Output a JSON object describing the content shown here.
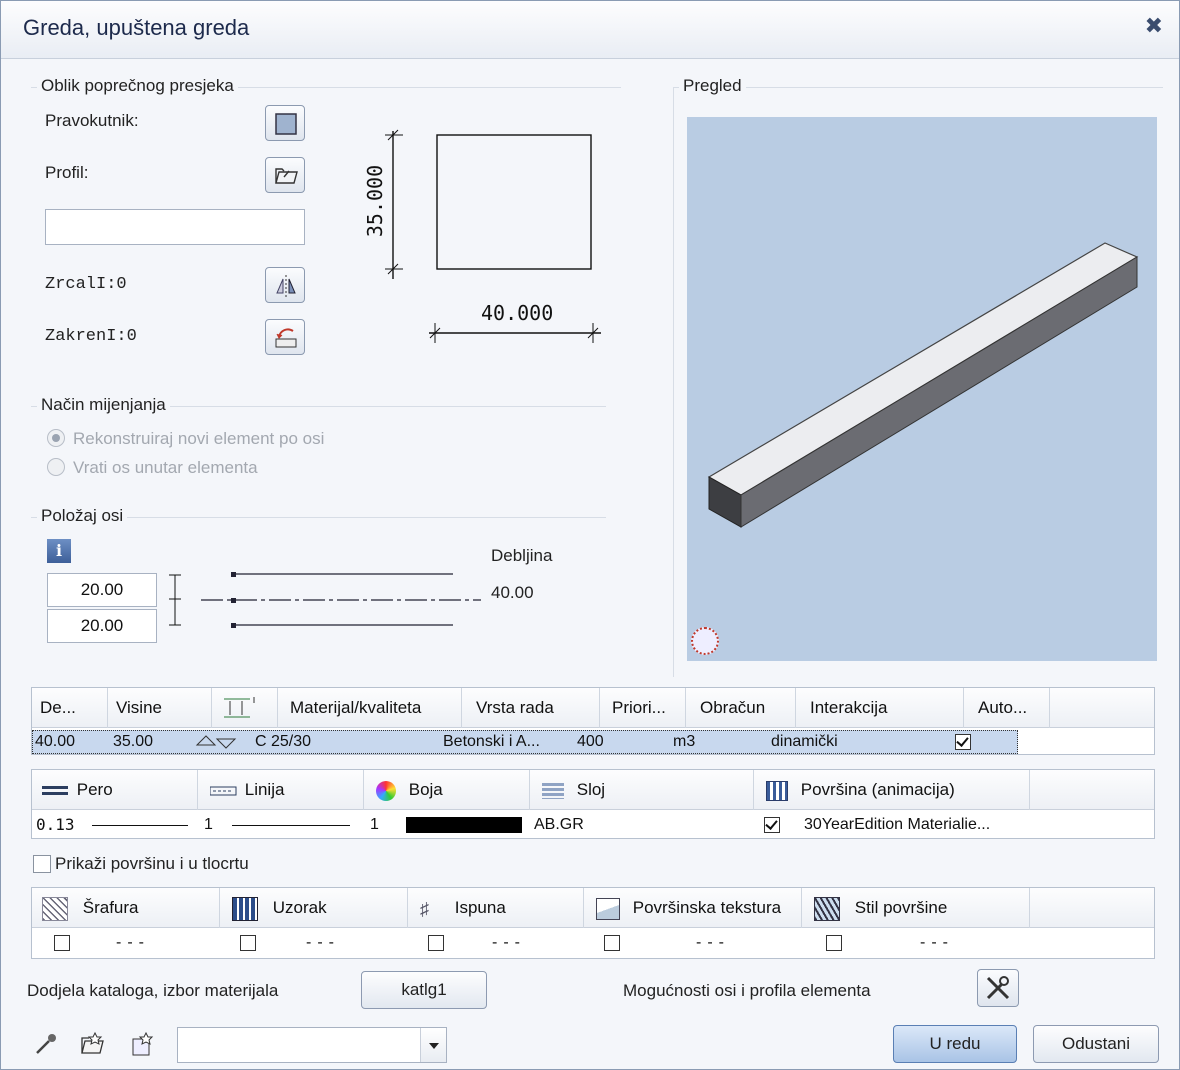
{
  "window": {
    "title": "Greda, upuštena greda",
    "close_glyph": "✖"
  },
  "section": {
    "title": "Oblik poprečnog presjeka",
    "rect_label": "Pravokutnik:",
    "profile_label": "Profil:",
    "profile_value": "",
    "mirror_label": "ZrcalI:0",
    "rotate_label": "ZakrenI:0",
    "height_dim": "35.000",
    "width_dim": "40.000"
  },
  "preview": {
    "title": "Pregled"
  },
  "mode": {
    "title": "Način mijenjanja",
    "opt1": "Rekonstruiraj novi element po osi",
    "opt2": "Vrati os unutar elementa",
    "selected": "opt1"
  },
  "axis": {
    "title": "Položaj osi",
    "top": "20.00",
    "bottom": "20.00",
    "thickness_label": "Debljina",
    "thickness_value": "40.00"
  },
  "table1": {
    "headers": [
      "De...",
      "Visine",
      "",
      "Materijal/kvaliteta",
      "Vrsta rada",
      "Priori...",
      "Obračun",
      "Interakcija",
      "Auto..."
    ],
    "row": [
      "40.00",
      "35.00",
      "",
      "C 25/30",
      "Betonski i A...",
      "400",
      "m3",
      "dinamički",
      ""
    ]
  },
  "table2": {
    "headers": [
      "Pero",
      "Linija",
      "Boja",
      "Sloj",
      "Površina (animacija)"
    ],
    "row": {
      "pen": "0.13",
      "line": "1",
      "color": "1",
      "layer": "AB.GR",
      "surface": "30YearEdition Materialie..."
    }
  },
  "show_surface": {
    "label": "Prikaži površinu i u tlocrtu",
    "checked": false
  },
  "table3": {
    "headers": [
      "Šrafura",
      "Uzorak",
      "Ispuna",
      "Površinska tekstura",
      "Stil površine"
    ],
    "dashes": "---"
  },
  "catalog": {
    "label": "Dodjela kataloga, izbor materijala",
    "button": "katlg1"
  },
  "options_label": "Mogućnosti osi i profila elementa",
  "footer": {
    "ok": "U redu",
    "cancel": "Odustani",
    "combo_value": ""
  },
  "colors": {
    "accent": "#a9c4e6",
    "preview_bg": "#b9cce3"
  }
}
